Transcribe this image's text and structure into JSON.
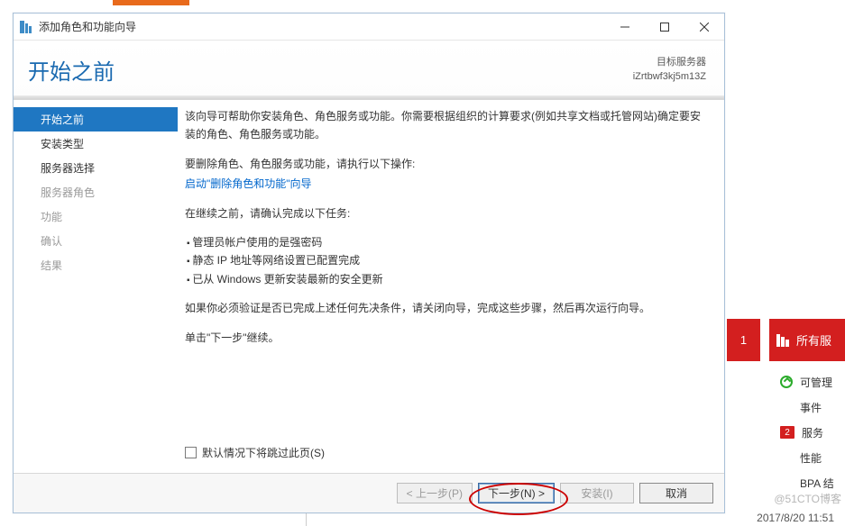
{
  "titlebar": {
    "title": "添加角色和功能向导"
  },
  "header": {
    "title": "开始之前",
    "target_label": "目标服务器",
    "target_server": "iZrtbwf3kj5m13Z"
  },
  "nav": {
    "items": [
      {
        "label": "开始之前",
        "state": "selected"
      },
      {
        "label": "安装类型",
        "state": "enabled"
      },
      {
        "label": "服务器选择",
        "state": "enabled"
      },
      {
        "label": "服务器角色",
        "state": "disabled"
      },
      {
        "label": "功能",
        "state": "disabled"
      },
      {
        "label": "确认",
        "state": "disabled"
      },
      {
        "label": "结果",
        "state": "disabled"
      }
    ]
  },
  "content": {
    "intro": "该向导可帮助你安装角色、角色服务或功能。你需要根据组织的计算要求(例如共享文档或托管网站)确定要安装的角色、角色服务或功能。",
    "remove_lead": "要删除角色、角色服务或功能，请执行以下操作:",
    "remove_link": "启动\"删除角色和功能\"向导",
    "tasks_lead": "在继续之前，请确认完成以下任务:",
    "bullets": [
      "管理员帐户使用的是强密码",
      "静态 IP 地址等网络设置已配置完成",
      "已从 Windows 更新安装最新的安全更新"
    ],
    "verify": "如果你必须验证是否已完成上述任何先决条件，请关闭向导，完成这些步骤，然后再次运行向导。",
    "proceed": "单击\"下一步\"继续。",
    "skip_label": "默认情况下将跳过此页(S)"
  },
  "buttons": {
    "prev": "< 上一步(P)",
    "next": "下一步(N) >",
    "install": "安装(I)",
    "cancel": "取消"
  },
  "background": {
    "tile_number": "1",
    "side_header": "所有服",
    "side_items": [
      "可管理",
      "事件",
      "服务",
      "性能",
      "BPA 结"
    ],
    "side_badge": "2"
  },
  "watermark": "@51CTO博客",
  "clock": "2017/8/20 11:51"
}
